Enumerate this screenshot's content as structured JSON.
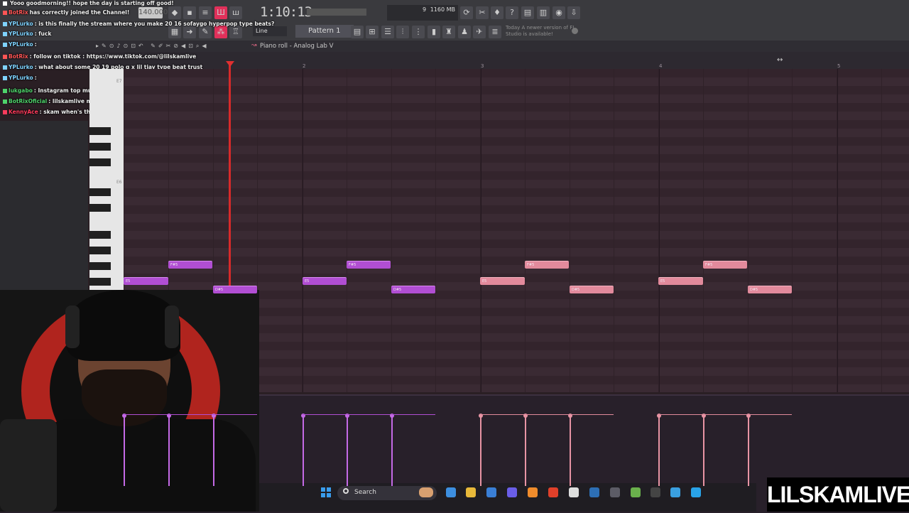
{
  "chat": {
    "messages": [
      {
        "user": "",
        "text": "Yooo goodmorning!! hope the day is starting off good!",
        "user_color": "#ffffff"
      },
      {
        "user": "BotRix",
        "text": "has correctly joined the Channel!",
        "user_color": "#ff5555"
      },
      {
        "user": "YPLurko",
        "text": ": is this finally the stream where you make 20 16 sofaygo hyperpop type beats?",
        "user_color": "#7fd3ff"
      },
      {
        "user": "YPLurko",
        "text": ": fuck",
        "user_color": "#7fd3ff"
      },
      {
        "user": "YPLurko",
        "text": ":",
        "user_color": "#7fd3ff"
      },
      {
        "user": "BotRix",
        "text": ": follow on tiktok : https://www.tiktok.com/@lilskamlive",
        "user_color": "#ff5555"
      },
      {
        "user": "YPLurko",
        "text": ": what about some 20 19 polo g x lil tjay type beat trust",
        "user_color": "#7fd3ff"
      },
      {
        "user": "YPLurko",
        "text": ":",
        "user_color": "#7fd3ff"
      },
      {
        "user": "lukgabo",
        "text": ": Instagram top must eat a lot of girls",
        "user_color": "#4ed36b"
      },
      {
        "user": "BotRixOficial",
        "text": ": lilskamlive makes music",
        "user_color": "#4ed36b"
      },
      {
        "user": "KennyAce",
        "text": ": skam when's the content starting",
        "user_color": "#ff3b5c"
      }
    ]
  },
  "toolbar": {
    "tempo": "140.000",
    "song_time": "1:10:13",
    "cpu_num": "9",
    "memory": "1160 MB",
    "mode": "Line",
    "pattern": "Pattern 1",
    "update_msg": "Today  A newer version of FL Studio is available!"
  },
  "piano_roll": {
    "title": "Piano roll - Analog Lab V",
    "octave_labels": [
      "E7",
      "E6"
    ],
    "bar_numbers": [
      "2",
      "3",
      "4",
      "5"
    ],
    "notes": [
      {
        "label": "E5",
        "color": "purple"
      },
      {
        "label": "F#5",
        "color": "purple"
      },
      {
        "label": "D#5",
        "color": "purple"
      },
      {
        "label": "E5",
        "color": "purple"
      },
      {
        "label": "F#5",
        "color": "purple"
      },
      {
        "label": "D#5",
        "color": "purple"
      },
      {
        "label": "E5",
        "color": "pink"
      },
      {
        "label": "F#5",
        "color": "pink"
      },
      {
        "label": "D#5",
        "color": "pink"
      },
      {
        "label": "E5",
        "color": "pink"
      },
      {
        "label": "F#5",
        "color": "pink"
      },
      {
        "label": "D#5",
        "color": "pink"
      }
    ]
  },
  "taskbar": {
    "search_label": "Search"
  },
  "brand": "LILSKAMLIVE",
  "colors": {
    "note_purple": "#b14ed3",
    "note_pink": "#e28a9c",
    "playhead": "#d72a2a"
  }
}
